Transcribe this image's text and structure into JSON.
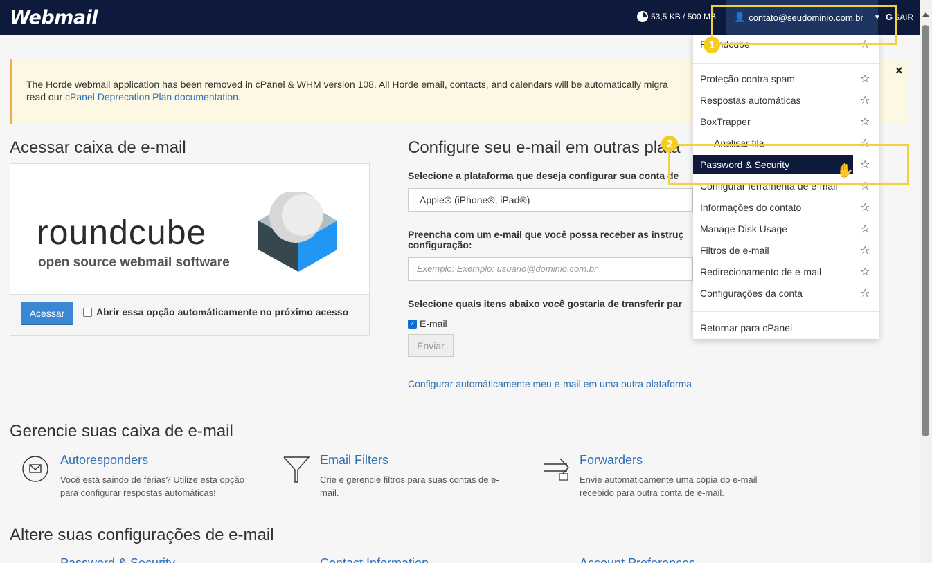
{
  "header": {
    "logo": "Webmail",
    "disk_usage": "53,5 KB / 500 MB",
    "user": "contato@seudominio.com.br",
    "logout": "SAIR"
  },
  "alert": {
    "text": "The Horde webmail application has been removed in cPanel & WHM version 108. All Horde email, contacts, and calendars will be automatically migra",
    "text_end": ",",
    "line2_prefix": "read our ",
    "link": "cPanel Deprecation Plan documentation",
    "line2_suffix": ".",
    "close": "×"
  },
  "access": {
    "title": "Acessar caixa de e-mail",
    "logo_word": "roundcube",
    "logo_sub": "open source webmail software",
    "button": "Acessar",
    "auto_open": "Abrir essa opção automáticamente no próximo acesso"
  },
  "configure": {
    "title": "Configure seu e-mail em outras plata",
    "platform_label": "Selecione a plataforma que deseja configurar sua conta de",
    "platform_value": "Apple® (iPhone®, iPad®)",
    "email_label_1": "Preencha com um e-mail que você possa receber as instruç",
    "email_label_2": "configuração:",
    "email_placeholder": "Exemplo: Exemplo: usuario@dominio.com.br",
    "items_label": "Selecione quais itens abaixo você gostaria de transferir par",
    "item_email": "E-mail",
    "send": "Enviar",
    "auto_link": "Configurar automáticamente meu e-mail em uma outra plataforma"
  },
  "manage": {
    "title": "Gerencie suas caixa de e-mail",
    "features": [
      {
        "title": "Autoresponders",
        "desc": "Você está saindo de férias? Utilize esta opção para configurar respostas automáticas!"
      },
      {
        "title": "Email Filters",
        "desc": "Crie e gerencie filtros para suas contas de e-mail."
      },
      {
        "title": "Forwarders",
        "desc": "Envie automaticamente uma cópia do e-mail recebido para outra conta de e-mail."
      }
    ]
  },
  "settings": {
    "title": "Altere suas configurações de e-mail",
    "links": [
      "Password & Security",
      "Contact Information",
      "Account Preferences"
    ]
  },
  "dropdown": {
    "items": [
      "Roundcube",
      "Proteção contra spam",
      "Respostas automáticas",
      "BoxTrapper",
      "Analisar fila",
      "Password & Security",
      "Configurar ferramenta de e-mail",
      "Informações do contato",
      "Manage Disk Usage",
      "Filtros de e-mail",
      "Redirecionamento de e-mail",
      "Configurações da conta",
      "Retornar para cPanel"
    ]
  },
  "annotations": {
    "badge1": "1",
    "badge2": "2",
    "highlight_color": "#f2d23b"
  },
  "colors": {
    "nav": "#0d1a3b",
    "link": "#2e70b7",
    "primary": "#3a87d4"
  }
}
